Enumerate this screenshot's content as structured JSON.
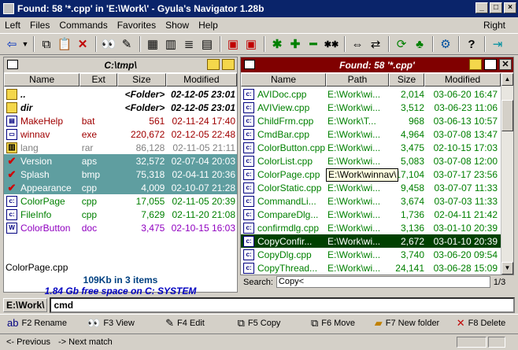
{
  "title": "Found: 58 '*.cpp' in 'E:\\Work\\' - Gyula's Navigator 1.28b",
  "menu": [
    "Left",
    "Files",
    "Commands",
    "Favorites",
    "Show",
    "Help"
  ],
  "menu_right": "Right",
  "left_panel": {
    "path": "C:\\tmp\\",
    "columns": [
      "Name",
      "Ext",
      "Size",
      "Modified"
    ],
    "rows": [
      {
        "name": "..",
        "ext": "",
        "size": "<Folder>",
        "modified": "02-12-05 23:01",
        "icon": "folder-up-icon",
        "color": "#000000",
        "selected": false,
        "bold": true
      },
      {
        "name": "dir",
        "ext": "",
        "size": "<Folder>",
        "modified": "02-12-05 23:01",
        "icon": "folder-icon",
        "color": "#000000",
        "selected": false,
        "bold": true
      },
      {
        "name": "MakeHelp",
        "ext": "bat",
        "size": "561",
        "modified": "02-11-24 17:40",
        "icon": "batch-icon",
        "color": "#a00000",
        "selected": false,
        "bold": false
      },
      {
        "name": "winnav",
        "ext": "exe",
        "size": "220,672",
        "modified": "02-12-05 22:48",
        "icon": "exe-icon",
        "color": "#a00000",
        "selected": false,
        "bold": false
      },
      {
        "name": "lang",
        "ext": "rar",
        "size": "86,128",
        "modified": "02-11-05 21:11",
        "icon": "archive-icon",
        "color": "#808080",
        "selected": false,
        "bold": false
      },
      {
        "name": "Version",
        "ext": "aps",
        "size": "32,572",
        "modified": "02-07-04 20:03",
        "icon": "check-icon",
        "color": "#ffffff",
        "selected": true,
        "bold": false
      },
      {
        "name": "Splash",
        "ext": "bmp",
        "size": "75,318",
        "modified": "02-04-11 20:36",
        "icon": "check-icon",
        "color": "#ffffff",
        "selected": true,
        "bold": false
      },
      {
        "name": "Appearance",
        "ext": "cpp",
        "size": "4,009",
        "modified": "02-10-07 21:28",
        "icon": "check-icon",
        "color": "#ffffff",
        "selected": true,
        "bold": false
      },
      {
        "name": "ColorPage",
        "ext": "cpp",
        "size": "17,055",
        "modified": "02-11-05 20:39",
        "icon": "cpp-icon",
        "color": "#008000",
        "selected": false,
        "bold": false
      },
      {
        "name": "FileInfo",
        "ext": "cpp",
        "size": "7,629",
        "modified": "02-11-20 21:08",
        "icon": "cpp-icon",
        "color": "#008000",
        "selected": false,
        "bold": false
      },
      {
        "name": "ColorButton",
        "ext": "doc",
        "size": "3,475",
        "modified": "02-10-15 16:03",
        "icon": "doc-icon",
        "color": "#9000c0",
        "selected": false,
        "bold": false
      }
    ],
    "current_file": "ColorPage.cpp",
    "summary": "109Kb in 3 items",
    "free_space": "1.84 Gb free space on C: SYSTEM"
  },
  "right_panel": {
    "header": "Found: 58 '*.cpp'",
    "columns": [
      "Name",
      "Path",
      "Size",
      "Modified"
    ],
    "rows": [
      {
        "name": "AVIDoc.cpp",
        "path": "E:\\Work\\wi...",
        "size": "2,014",
        "modified": "03-06-20 16:47",
        "selected": false
      },
      {
        "name": "AVIView.cpp",
        "path": "E:\\Work\\wi...",
        "size": "3,512",
        "modified": "03-06-23 11:06",
        "selected": false
      },
      {
        "name": "ChildFrm.cpp",
        "path": "E:\\Work\\T...",
        "size": "968",
        "modified": "03-06-13 10:57",
        "selected": false
      },
      {
        "name": "CmdBar.cpp",
        "path": "E:\\Work\\wi...",
        "size": "4,964",
        "modified": "03-07-08 13:47",
        "selected": false
      },
      {
        "name": "ColorButton.cpp",
        "path": "E:\\Work\\wi...",
        "size": "3,475",
        "modified": "02-10-15 17:03",
        "selected": false
      },
      {
        "name": "ColorList.cpp",
        "path": "E:\\Work\\wi...",
        "size": "5,083",
        "modified": "03-07-08 12:00",
        "selected": false
      },
      {
        "name": "ColorPage.cpp",
        "path": "E:\\Work\\wi...",
        "size": "17,104",
        "modified": "03-07-17 23:56",
        "selected": false
      },
      {
        "name": "ColorStatic.cpp",
        "path": "E:\\Work\\wi...",
        "size": "9,458",
        "modified": "03-07-07 11:33",
        "selected": false
      },
      {
        "name": "CommandLi...",
        "path": "E:\\Work\\wi...",
        "size": "3,674",
        "modified": "03-07-03 11:33",
        "selected": false
      },
      {
        "name": "CompareDlg...",
        "path": "E:\\Work\\wi...",
        "size": "1,736",
        "modified": "02-04-11 21:42",
        "selected": false
      },
      {
        "name": "confirmdlg.cpp",
        "path": "E:\\Work\\wi...",
        "size": "3,136",
        "modified": "03-01-10 20:39",
        "selected": false
      },
      {
        "name": "CopyConfir...",
        "path": "E:\\Work\\wi...",
        "size": "2,672",
        "modified": "03-01-10 20:39",
        "selected": true
      },
      {
        "name": "CopyDlg.cpp",
        "path": "E:\\Work\\wi...",
        "size": "3,740",
        "modified": "03-06-20 09:54",
        "selected": false
      },
      {
        "name": "CopyThread...",
        "path": "E:\\Work\\wi...",
        "size": "24,141",
        "modified": "03-06-28 15:09",
        "selected": false
      }
    ],
    "tooltip": "E:\\Work\\winnav\\",
    "search_label": "Search:",
    "search_value": "Copy<",
    "match_count": "1/3"
  },
  "cmdline": {
    "path": "E:\\Work\\",
    "value": "cmd"
  },
  "fkeys": [
    {
      "label": "F2 Rename",
      "icon": "rename-icon"
    },
    {
      "label": "F3 View",
      "icon": "view-icon"
    },
    {
      "label": "F4 Edit",
      "icon": "edit-icon"
    },
    {
      "label": "F5 Copy",
      "icon": "copy-icon"
    },
    {
      "label": "F6 Move",
      "icon": "move-icon"
    },
    {
      "label": "F7 New folder",
      "icon": "new-folder-icon"
    },
    {
      "label": "F8 Delete",
      "icon": "delete-icon"
    }
  ],
  "hints": {
    "previous": "<- Previous",
    "next": "-> Next match"
  }
}
